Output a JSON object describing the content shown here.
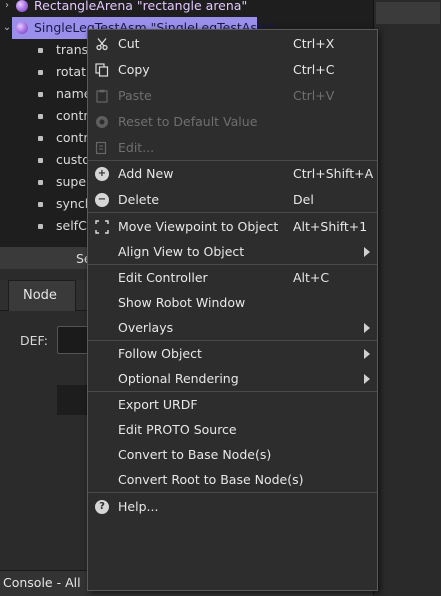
{
  "tree": {
    "rows": [
      {
        "label": "RectangleArena \"rectangle arena\""
      },
      {
        "label": "SingleLegTestAsm \"SingleLegTestAsm\""
      }
    ],
    "fields": [
      "transl",
      "rotatio",
      "name",
      "contro",
      "contro",
      "custo",
      "super",
      "synch",
      "selfCo"
    ]
  },
  "panel": {
    "segment_label": "Se",
    "tab_node": "Node",
    "def_label": "DEF:"
  },
  "console": {
    "title": "Console - All"
  },
  "menu": {
    "items": [
      {
        "label": "Cut",
        "shortcut": "Ctrl+X"
      },
      {
        "label": "Copy",
        "shortcut": "Ctrl+C"
      },
      {
        "label": "Paste",
        "shortcut": "Ctrl+V"
      },
      {
        "label": "Reset to Default Value",
        "shortcut": ""
      },
      {
        "label": "Edit...",
        "shortcut": ""
      },
      {
        "label": "Add New",
        "shortcut": "Ctrl+Shift+A"
      },
      {
        "label": "Delete",
        "shortcut": "Del"
      },
      {
        "label": "Move Viewpoint to Object",
        "shortcut": "Alt+Shift+1"
      },
      {
        "label": "Align View to Object",
        "shortcut": ""
      },
      {
        "label": "Edit Controller",
        "shortcut": "Alt+C"
      },
      {
        "label": "Show Robot Window",
        "shortcut": ""
      },
      {
        "label": "Overlays",
        "shortcut": ""
      },
      {
        "label": "Follow Object",
        "shortcut": ""
      },
      {
        "label": "Optional Rendering",
        "shortcut": ""
      },
      {
        "label": "Export URDF",
        "shortcut": ""
      },
      {
        "label": "Edit PROTO Source",
        "shortcut": ""
      },
      {
        "label": "Convert to Base Node(s)",
        "shortcut": ""
      },
      {
        "label": "Convert Root to Base Node(s)",
        "shortcut": ""
      },
      {
        "label": "Help...",
        "shortcut": ""
      }
    ]
  },
  "colors": {
    "selection": "#9a8fea",
    "node_text": "#e3c7ff"
  }
}
